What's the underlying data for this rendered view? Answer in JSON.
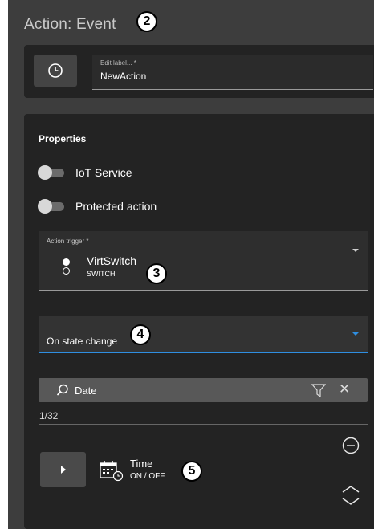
{
  "header": {
    "title": "Action: Event",
    "badge": "2"
  },
  "label_field": {
    "label": "Edit label... *",
    "value": "NewAction"
  },
  "properties": {
    "heading": "Properties",
    "toggles": [
      {
        "label": "IoT Service",
        "on": false
      },
      {
        "label": "Protected action",
        "on": false
      }
    ]
  },
  "trigger": {
    "label": "Action trigger *",
    "name": "VirtSwitch",
    "type": "SWITCH",
    "badge": "3"
  },
  "state_select": {
    "value": "On state change",
    "badge": "4"
  },
  "search": {
    "value": "Date"
  },
  "count": "1/32",
  "item": {
    "name": "Time",
    "sub": "ON / OFF",
    "badge": "5"
  },
  "colors": {
    "accent": "#2f8ee0",
    "panel": "#232323",
    "background": "#3d3d3d"
  },
  "icons": [
    "clock-icon",
    "chevron-down-icon",
    "search-icon",
    "filter-icon",
    "close-icon",
    "minus-circle-icon",
    "chevron-up-down-icon",
    "play-icon",
    "calendar-clock-icon"
  ]
}
